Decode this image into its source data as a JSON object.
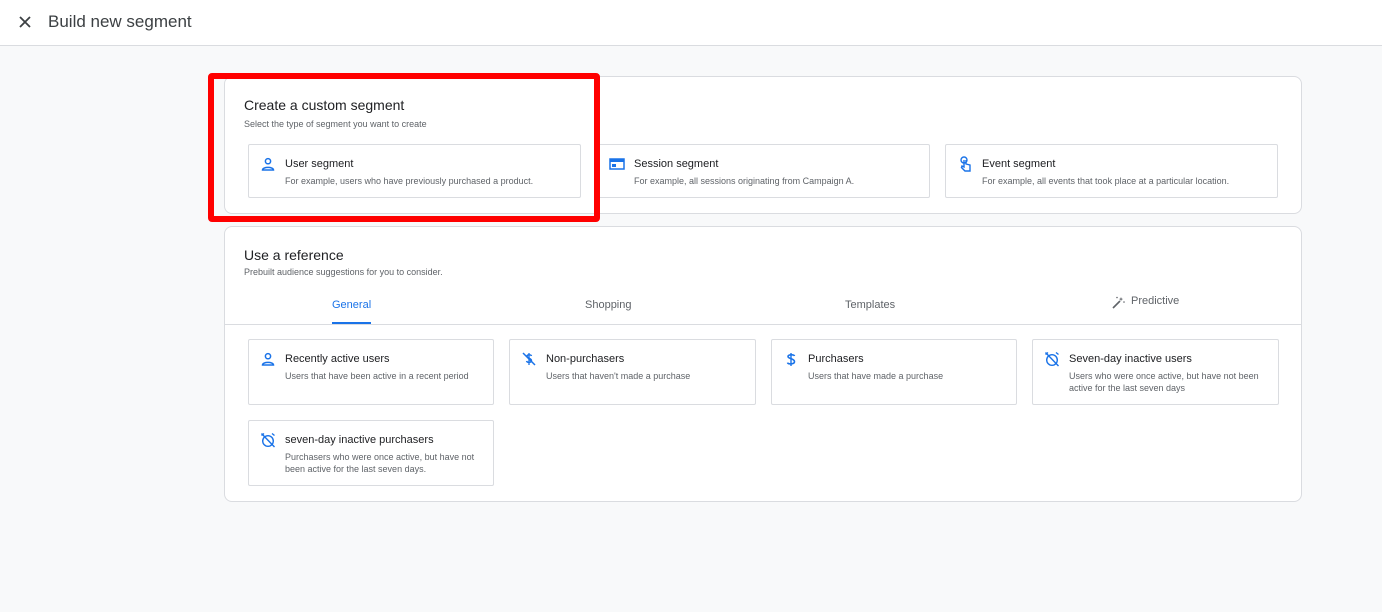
{
  "header": {
    "title": "Build new segment",
    "close_icon": "close-icon"
  },
  "custom_segment": {
    "title": "Create a custom segment",
    "subtitle": "Select the type of segment you want to create",
    "options": [
      {
        "title": "User segment",
        "description": "For example, users who have previously purchased a product.",
        "icon": "person-icon"
      },
      {
        "title": "Session segment",
        "description": "For example, all sessions originating from Campaign A.",
        "icon": "session-icon"
      },
      {
        "title": "Event segment",
        "description": "For example, all events that took place at a particular location.",
        "icon": "touch-icon"
      }
    ]
  },
  "reference": {
    "title": "Use a reference",
    "subtitle": "Prebuilt audience suggestions for you to consider.",
    "tabs": [
      {
        "label": "General",
        "active": true
      },
      {
        "label": "Shopping",
        "active": false
      },
      {
        "label": "Templates",
        "active": false
      },
      {
        "label": "Predictive",
        "active": false,
        "icon": "magic-wand-icon"
      }
    ],
    "items": [
      {
        "title": "Recently active users",
        "description": "Users that have been active in a recent period",
        "icon": "person-icon"
      },
      {
        "title": "Non-purchasers",
        "description": "Users that haven't made a purchase",
        "icon": "money-off-icon"
      },
      {
        "title": "Purchasers",
        "description": "Users that have made a purchase",
        "icon": "dollar-icon"
      },
      {
        "title": "Seven-day inactive users",
        "description": "Users who were once active, but have not been active for the last seven days",
        "icon": "alarm-off-icon"
      },
      {
        "title": "seven-day inactive purchasers",
        "description": "Purchasers who were once active, but have not been active for the last seven days.",
        "icon": "alarm-off-icon"
      }
    ]
  },
  "colors": {
    "accent": "#1a73e8",
    "highlight": "#ff0000",
    "icon": "#1a73e8"
  }
}
